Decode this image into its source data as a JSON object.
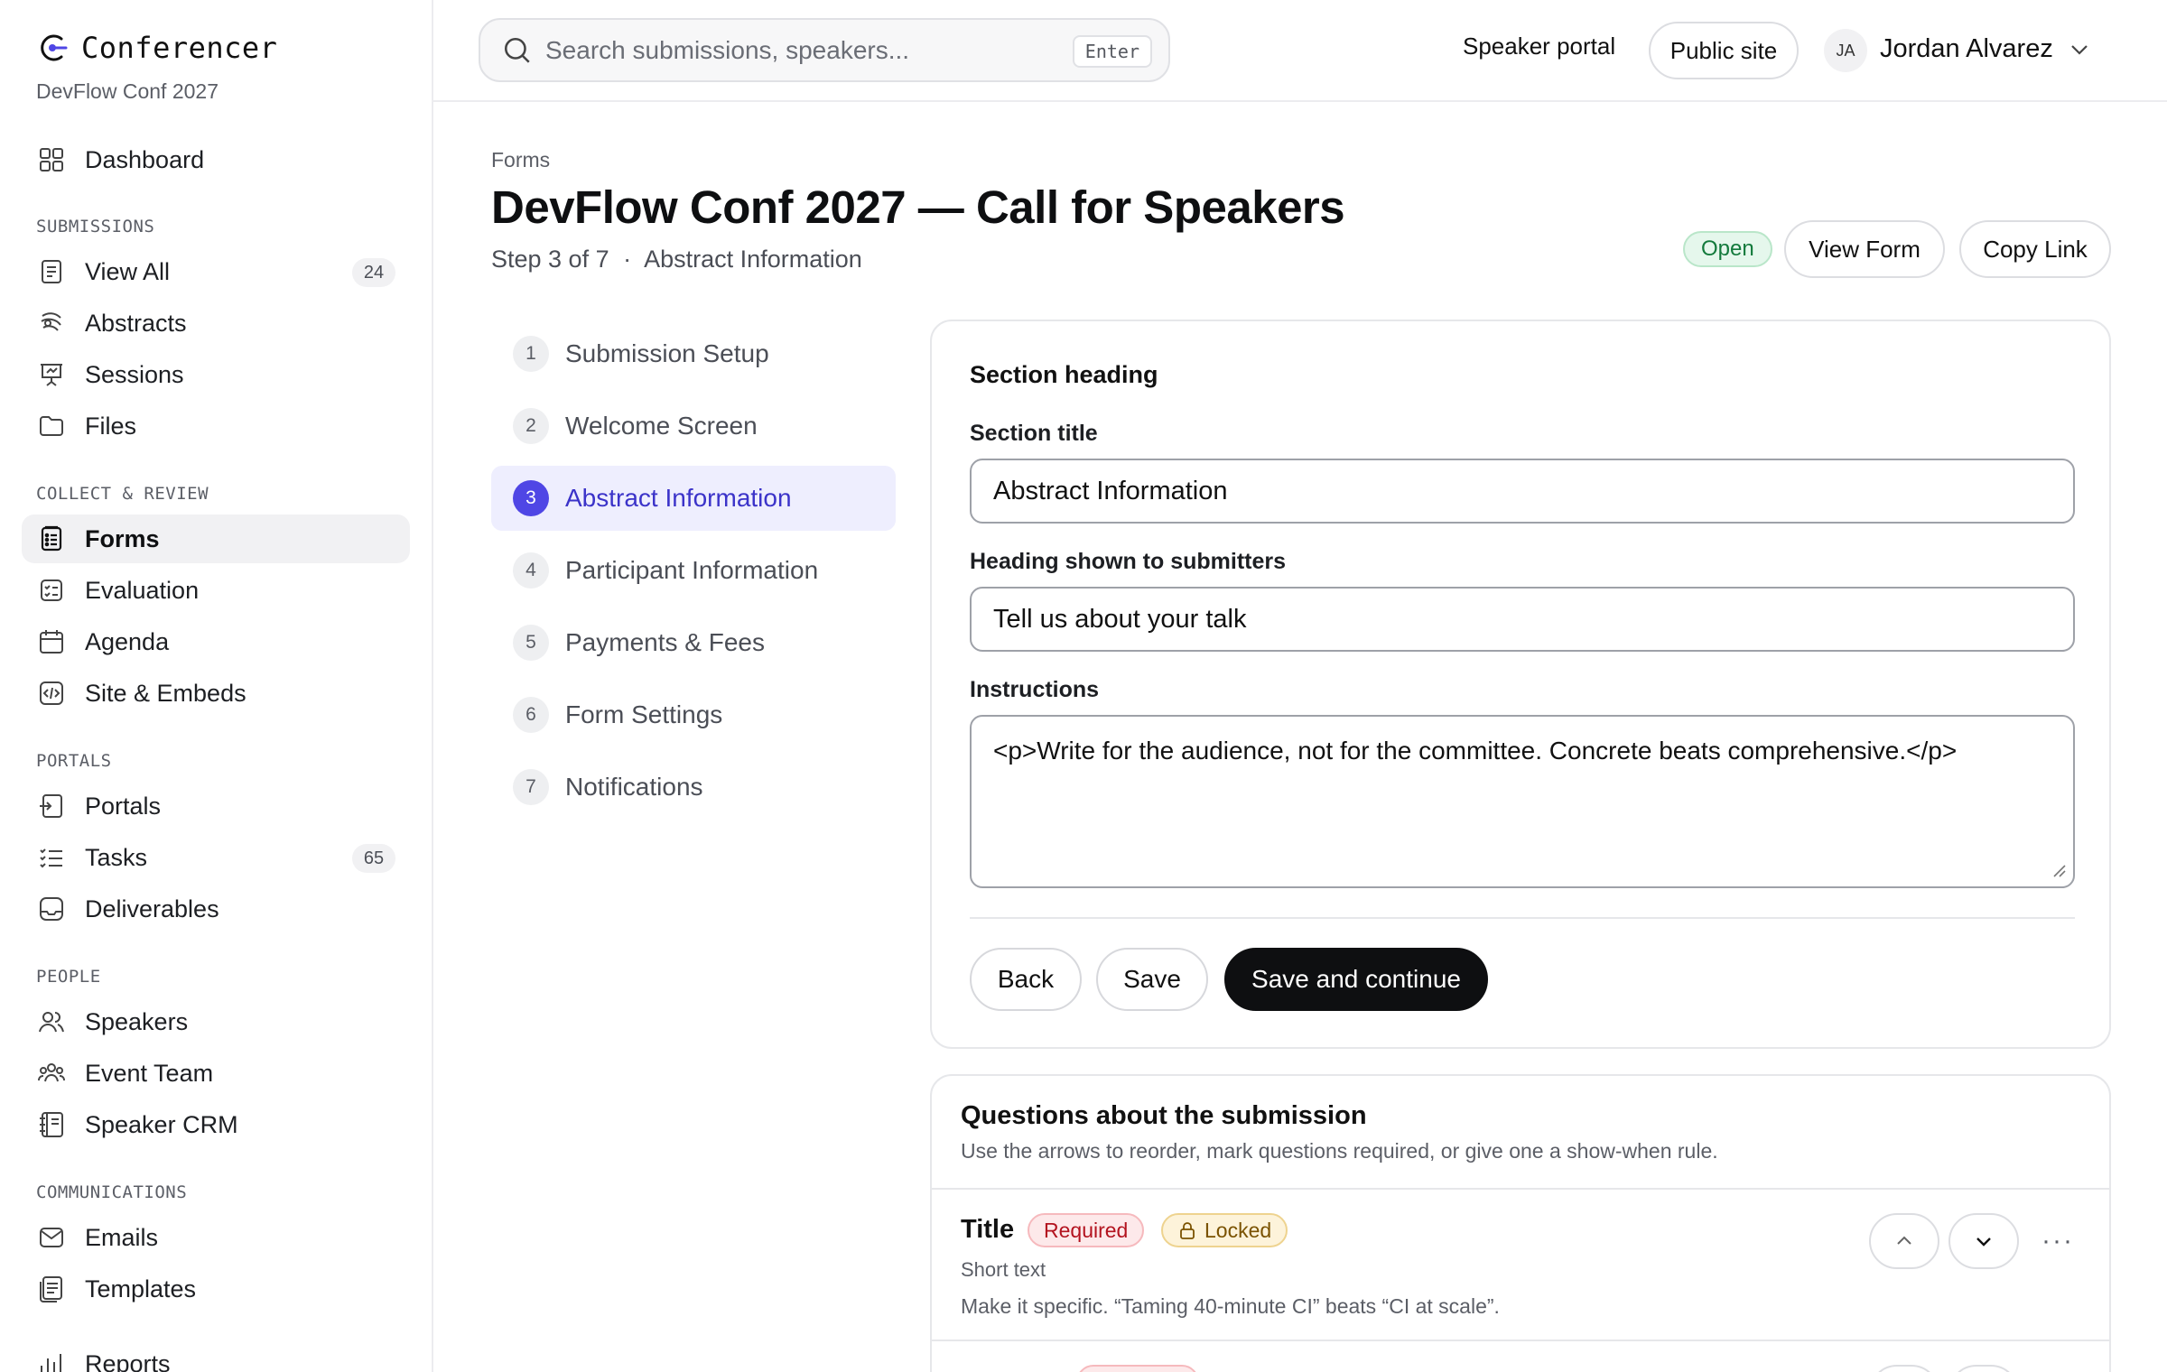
{
  "app": {
    "name": "Conferencer",
    "event": "DevFlow Conf 2027"
  },
  "sidebar": {
    "dashboard": {
      "label": "Dashboard",
      "icon": "dashboard-grid-icon"
    },
    "sections": [
      {
        "title": "SUBMISSIONS"
      },
      {
        "title": "COLLECT & REVIEW"
      },
      {
        "title": "PORTALS"
      },
      {
        "title": "PEOPLE"
      },
      {
        "title": "COMMUNICATIONS"
      }
    ],
    "items": [
      {
        "label": "View All",
        "badge": "24",
        "icon": "document-icon"
      },
      {
        "label": "Abstracts",
        "icon": "abstract-icon"
      },
      {
        "label": "Sessions",
        "icon": "presentation-icon"
      },
      {
        "label": "Files",
        "icon": "folder-icon"
      },
      {
        "label": "Forms",
        "icon": "form-list-icon",
        "active": true
      },
      {
        "label": "Evaluation",
        "icon": "checklist-icon"
      },
      {
        "label": "Agenda",
        "icon": "calendar-icon"
      },
      {
        "label": "Site & Embeds",
        "icon": "code-icon"
      },
      {
        "label": "Portals",
        "icon": "portal-icon"
      },
      {
        "label": "Tasks",
        "badge": "65",
        "icon": "tasks-icon"
      },
      {
        "label": "Deliverables",
        "icon": "inbox-icon"
      },
      {
        "label": "Speakers",
        "icon": "users-icon"
      },
      {
        "label": "Event Team",
        "icon": "team-icon"
      },
      {
        "label": "Speaker CRM",
        "icon": "contacts-book-icon"
      },
      {
        "label": "Emails",
        "icon": "mail-icon"
      },
      {
        "label": "Templates",
        "icon": "template-icon"
      },
      {
        "label": "Reports",
        "icon": "bar-chart-icon"
      }
    ]
  },
  "topbar": {
    "search_placeholder": "Search submissions, speakers...",
    "search_shortcut": "Enter",
    "speaker_portal": "Speaker portal",
    "public_site": "Public site",
    "user_initials": "JA",
    "user_name": "Jordan Alvarez"
  },
  "page": {
    "breadcrumb": "Forms",
    "title": "DevFlow Conf 2027 — Call for Speakers",
    "step_text": "Step 3 of 7",
    "step_separator": "·",
    "step_name": "Abstract Information",
    "status": "Open",
    "view_form": "View Form",
    "copy_link": "Copy Link"
  },
  "steps": [
    {
      "num": "1",
      "label": "Submission Setup"
    },
    {
      "num": "2",
      "label": "Welcome Screen"
    },
    {
      "num": "3",
      "label": "Abstract Information",
      "active": true
    },
    {
      "num": "4",
      "label": "Participant Information"
    },
    {
      "num": "5",
      "label": "Payments & Fees"
    },
    {
      "num": "6",
      "label": "Form Settings"
    },
    {
      "num": "7",
      "label": "Notifications"
    }
  ],
  "section_card": {
    "heading": "Section heading",
    "title_label": "Section title",
    "title_value": "Abstract Information",
    "heading_label": "Heading shown to submitters",
    "heading_value": "Tell us about your talk",
    "instructions_label": "Instructions",
    "instructions_value": "<p>Write for the audience, not for the committee. Concrete beats comprehensive.</p>",
    "back": "Back",
    "save": "Save",
    "save_continue": "Save and continue"
  },
  "questions_card": {
    "title": "Questions about the submission",
    "subtitle": "Use the arrows to reorder, mark questions required, or give one a show-when rule.",
    "questions": [
      {
        "name": "Title",
        "required": "Required",
        "locked": "Locked",
        "type": "Short text",
        "help": "Make it specific. “Taming 40-minute CI” beats “CI at scale”."
      }
    ]
  },
  "colors": {
    "accent": "#4f46e5",
    "accent_bg": "#eeeefe",
    "open_green": "#137a3c",
    "required_red": "#b3131f",
    "locked_amber": "#7a5200",
    "primary_button": "#0e0f11"
  }
}
